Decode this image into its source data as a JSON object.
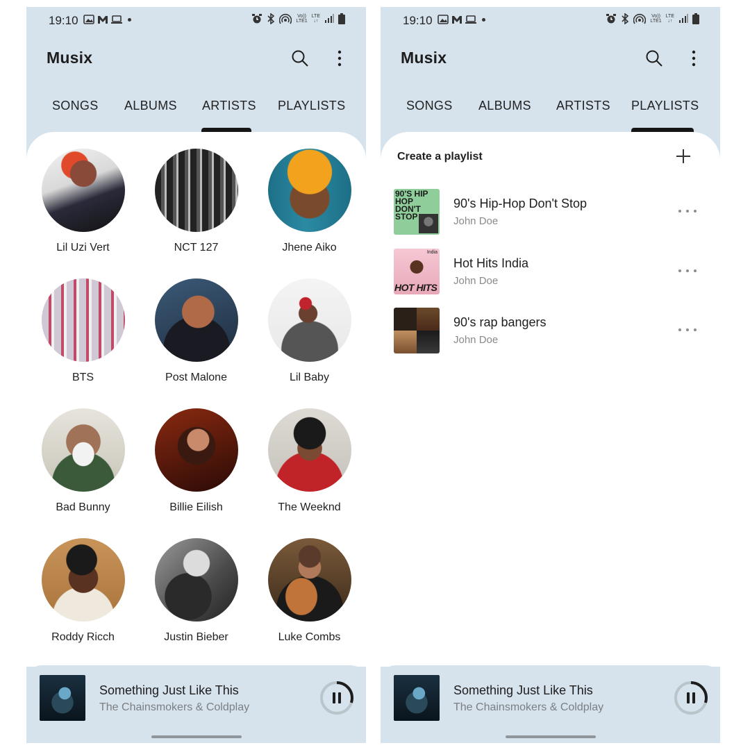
{
  "status_bar": {
    "time": "19:10",
    "lte_label_1": "Vo))",
    "lte_label_2": "LTE1",
    "lte_label_3": "LTE"
  },
  "app": {
    "title": "Musix"
  },
  "tabs": [
    {
      "label": "SONGS"
    },
    {
      "label": "ALBUMS"
    },
    {
      "label": "ARTISTS"
    },
    {
      "label": "PLAYLISTS"
    }
  ],
  "left_screen": {
    "selected_tab": "ARTISTS",
    "artists": [
      {
        "name": "Lil Uzi Vert"
      },
      {
        "name": "NCT 127"
      },
      {
        "name": "Jhene Aiko"
      },
      {
        "name": "BTS"
      },
      {
        "name": "Post Malone"
      },
      {
        "name": "Lil Baby"
      },
      {
        "name": "Bad Bunny"
      },
      {
        "name": "Billie Eilish"
      },
      {
        "name": "The Weeknd"
      },
      {
        "name": "Roddy Ricch"
      },
      {
        "name": "Justin Bieber"
      },
      {
        "name": "Luke Combs"
      }
    ]
  },
  "right_screen": {
    "selected_tab": "PLAYLISTS",
    "create_playlist_label": "Create a playlist",
    "playlists": [
      {
        "title": "90's Hip-Hop Don't Stop",
        "owner": "John Doe",
        "cover_text": "90'S HIP HOP DON'T STOP"
      },
      {
        "title": "Hot Hits India",
        "owner": "John Doe",
        "cover_text": "HOT HITS",
        "cover_badge": "India"
      },
      {
        "title": "90's rap bangers",
        "owner": "John Doe"
      }
    ]
  },
  "now_playing": {
    "title": "Something Just Like This",
    "artist": "The Chainsmokers & Coldplay",
    "progress": 0.3
  },
  "colors": {
    "app_background": "#d6e3ec",
    "sheet": "#ffffff",
    "accent": "#161616",
    "secondary_text": "#8a8a8a"
  }
}
